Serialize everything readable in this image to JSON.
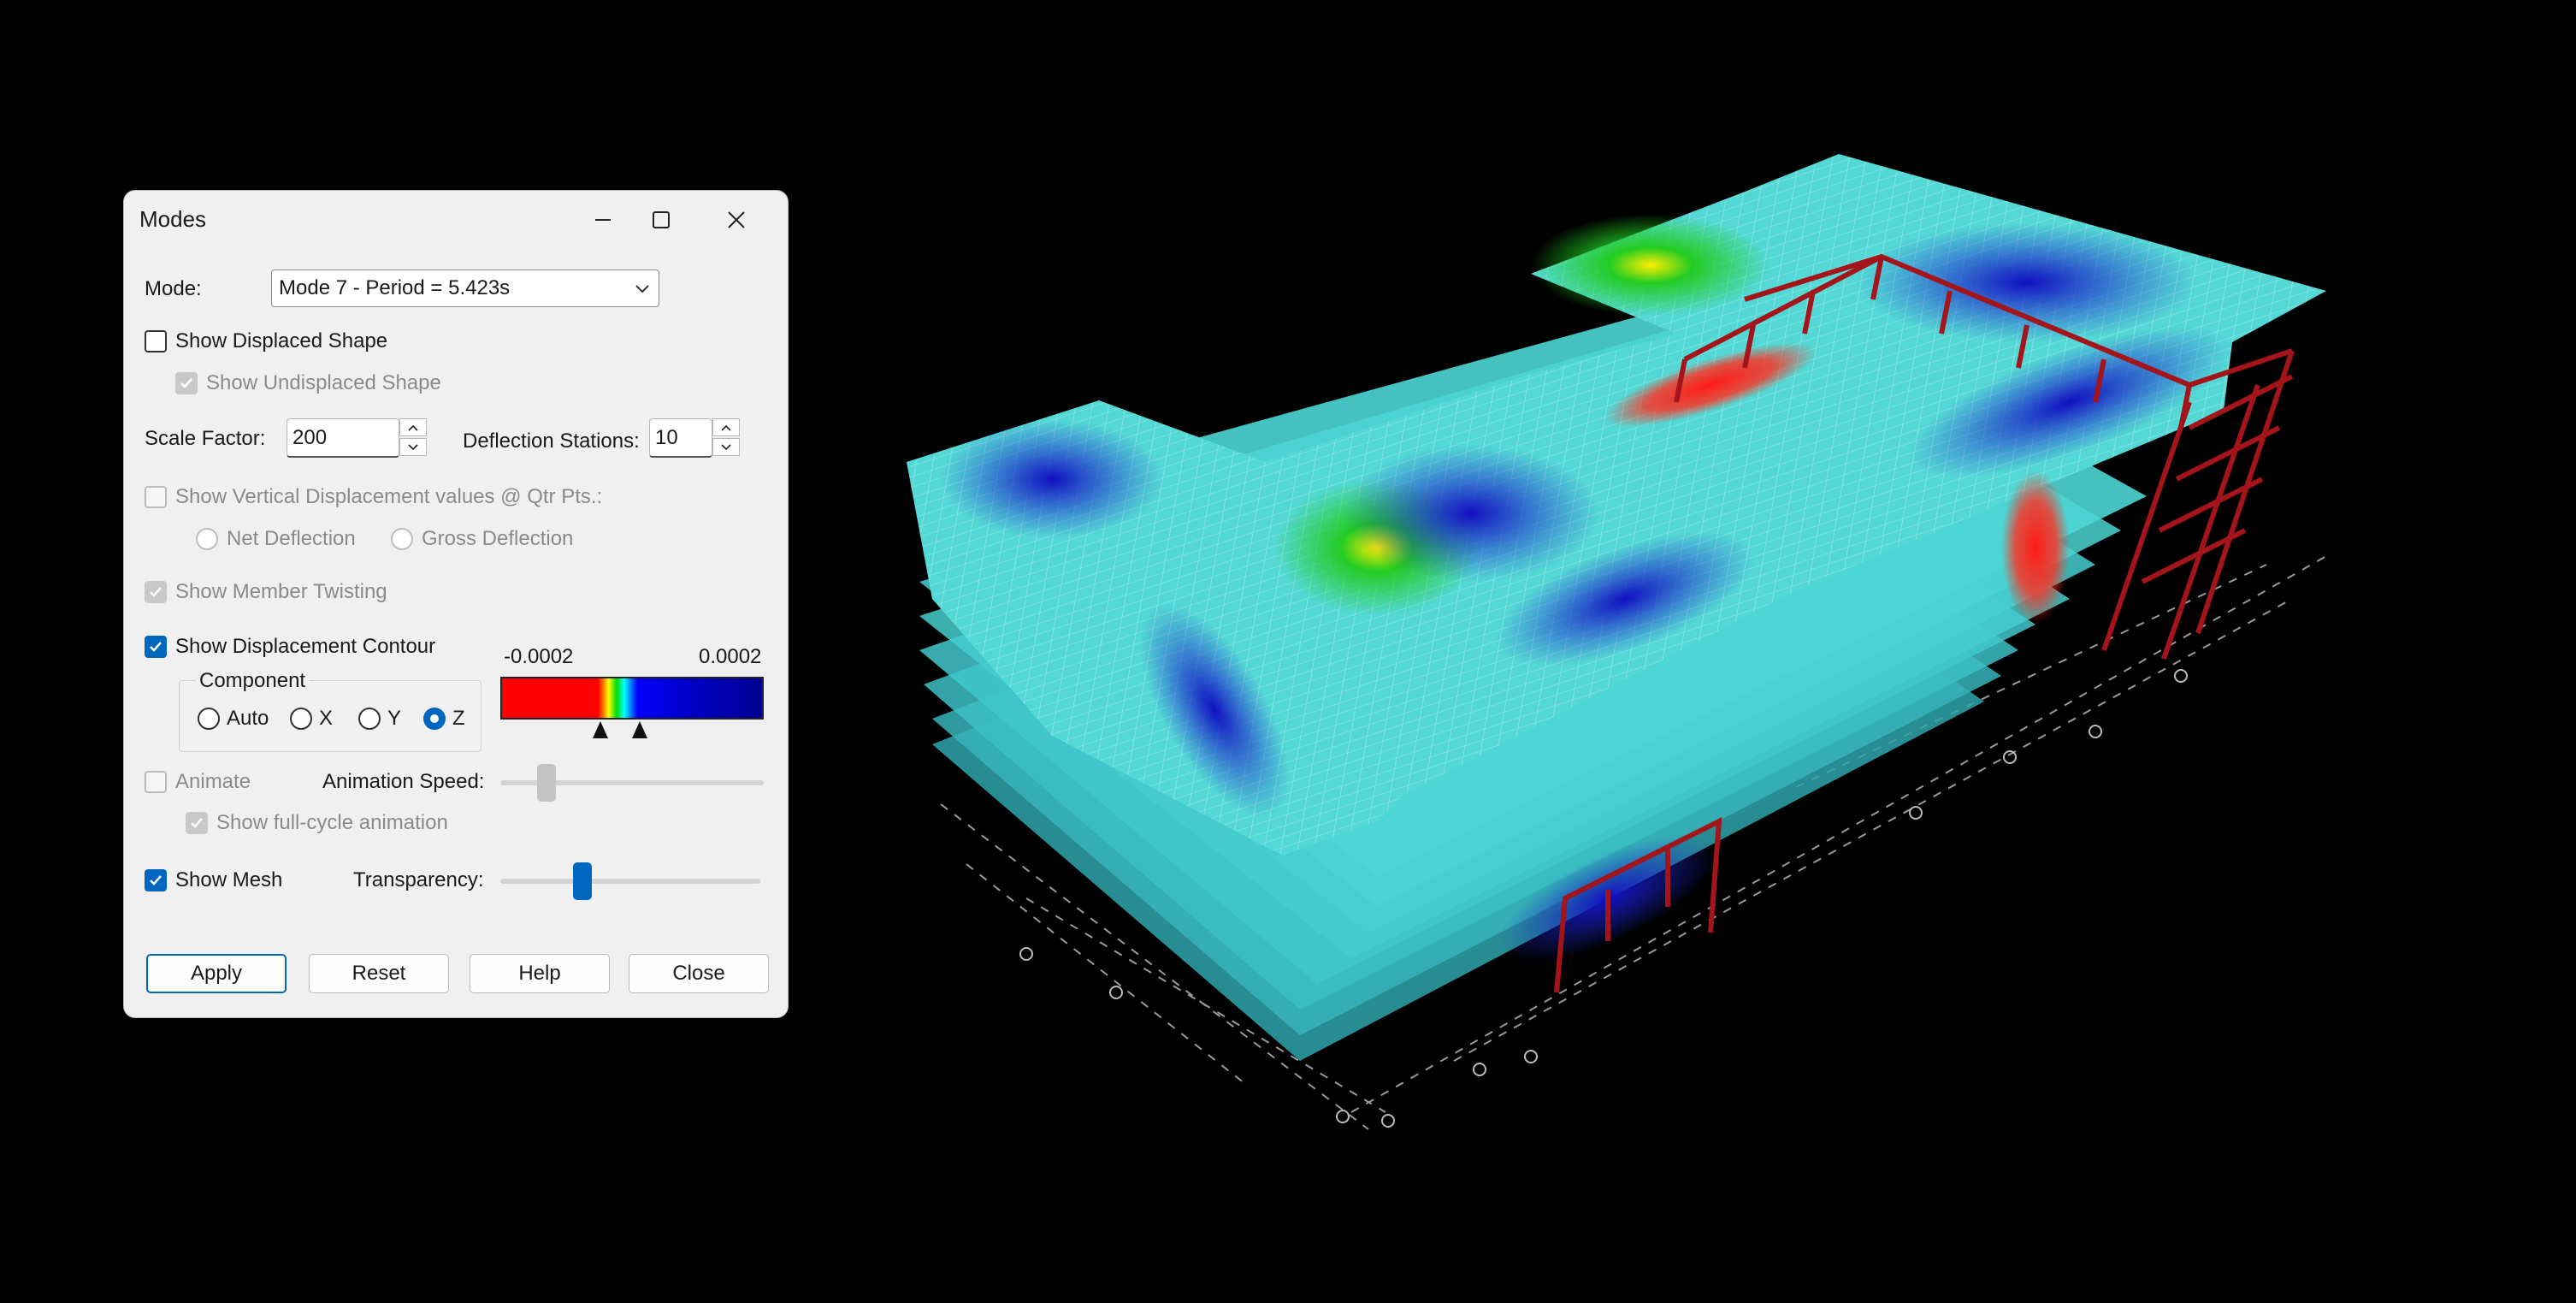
{
  "dialog": {
    "title": "Modes",
    "mode_label": "Mode:",
    "mode_value": "Mode 7 - Period = 5.423s",
    "show_displaced_shape": {
      "label": "Show Displaced Shape",
      "checked": false
    },
    "show_undisplaced_shape": {
      "label": "Show Undisplaced Shape",
      "checked": true,
      "enabled": false
    },
    "scale_factor": {
      "label": "Scale Factor:",
      "value": "200"
    },
    "deflection_stations": {
      "label": "Deflection Stations:",
      "value": "10"
    },
    "show_vertical_displacement": {
      "label": "Show Vertical Displacement values @ Qtr Pts.:",
      "checked": false,
      "enabled": false
    },
    "net_deflection": "Net Deflection",
    "gross_deflection": "Gross Deflection",
    "show_member_twisting": {
      "label": "Show Member Twisting",
      "checked": true,
      "enabled": false
    },
    "show_displacement_contour": {
      "label": "Show Displacement Contour",
      "checked": true
    },
    "component": {
      "label": "Component",
      "options": [
        "Auto",
        "X",
        "Y",
        "Z"
      ],
      "selected": "Z"
    },
    "contour_legend": {
      "min": "-0.0002",
      "max": "0.0002"
    },
    "animate": {
      "label": "Animate",
      "checked": false,
      "enabled": false
    },
    "animation_speed": {
      "label": "Animation Speed:",
      "level": 0.15
    },
    "show_full_cycle": {
      "label": "Show full-cycle animation",
      "checked": true,
      "enabled": false
    },
    "show_mesh": {
      "label": "Show Mesh",
      "checked": true
    },
    "transparency": {
      "label": "Transparency:",
      "level": 0.3
    },
    "buttons": {
      "apply": "Apply",
      "reset": "Reset",
      "help": "Help",
      "close": "Close"
    }
  },
  "colors": {
    "accent": "#0067c0",
    "contour_low": "#ff0000",
    "contour_high": "#000090",
    "mesh": "#3cc6c8",
    "frame": "#a3141b"
  }
}
